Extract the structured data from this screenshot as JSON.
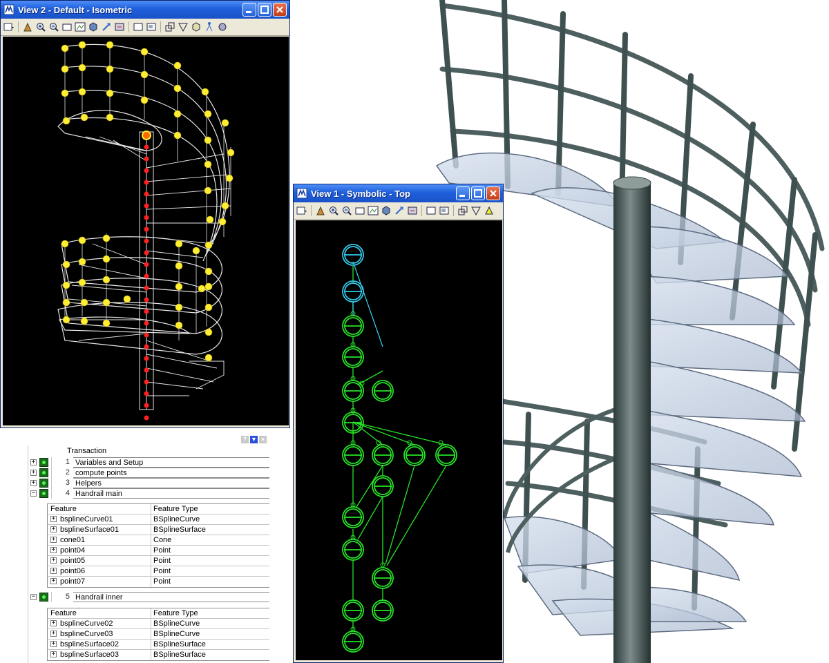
{
  "view2": {
    "title": "View 2 - Default - Isometric"
  },
  "view1": {
    "title": "View 1 - Symbolic - Top"
  },
  "panel": {
    "help_icon": "?",
    "filter_icon": "▼",
    "close_icon": "×",
    "header": "Transaction",
    "transactions": [
      {
        "num": "1",
        "name": "Variables and Setup",
        "expander": "+"
      },
      {
        "num": "2",
        "name": "compute points",
        "expander": "+"
      },
      {
        "num": "3",
        "name": "Helpers",
        "expander": "+"
      },
      {
        "num": "4",
        "name": "Handrail main",
        "expander": "−"
      },
      {
        "num": "5",
        "name": "Handrail inner",
        "expander": "−"
      }
    ],
    "features_4": {
      "col1": "Feature",
      "col2": "Feature Type",
      "rows": [
        {
          "feature": "bsplineCurve01",
          "type": "BSplineCurve"
        },
        {
          "feature": "bsplineSurface01",
          "type": "BSplineSurface"
        },
        {
          "feature": "cone01",
          "type": "Cone"
        },
        {
          "feature": "point04",
          "type": "Point"
        },
        {
          "feature": "point05",
          "type": "Point"
        },
        {
          "feature": "point06",
          "type": "Point"
        },
        {
          "feature": "point07",
          "type": "Point"
        }
      ]
    },
    "features_5": {
      "col1": "Feature",
      "col2": "Feature Type",
      "rows": [
        {
          "feature": "bsplineCurve02",
          "type": "BSplineCurve"
        },
        {
          "feature": "bsplineCurve03",
          "type": "BSplineCurve"
        },
        {
          "feature": "bsplineSurface02",
          "type": "BSplineSurface"
        },
        {
          "feature": "bsplineSurface03",
          "type": "BSplineSurface"
        }
      ]
    }
  },
  "colors": {
    "titlebar": "#1f5fdb",
    "viewport": "#000000",
    "wire": "#e8e8e8",
    "control_point": "#ffee33",
    "axis_point": "#ff2020",
    "graph_node": "#27e427",
    "graph_root": "#34c8e8",
    "status_green": "#47ff47"
  }
}
